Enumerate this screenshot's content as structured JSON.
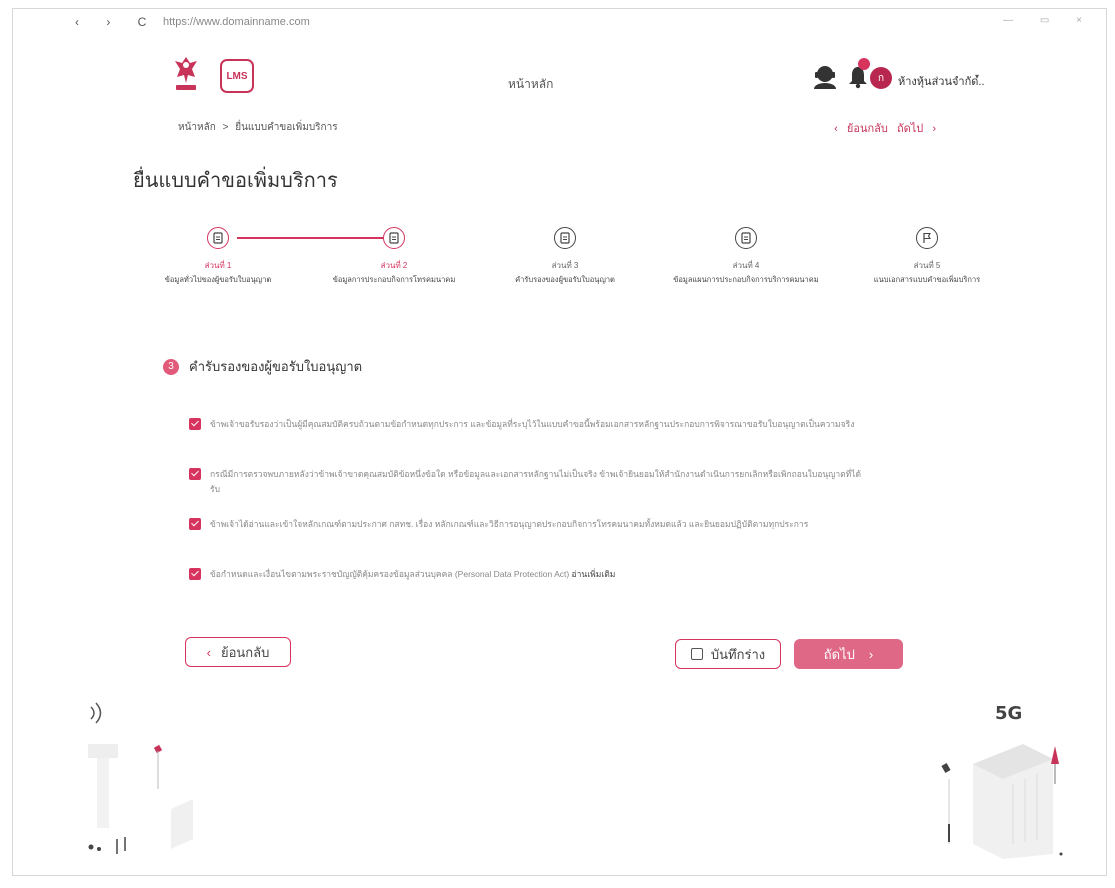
{
  "browser": {
    "url": "https://www.domainname.com",
    "nav_glyphs": "‹ › C",
    "window_glyphs": "— ▭ ×"
  },
  "header": {
    "home_title": "หน้าหลัก",
    "logo2_text": "LMS",
    "user_name": "ห้างหุ้นส่วนจำกัด..",
    "avatar_letter": "ก",
    "chevron": "▾"
  },
  "breadcrumb": {
    "home": "หน้าหลัก",
    "separator": ">",
    "current": "ยื่นแบบคำขอเพิ่มบริการ"
  },
  "top_nav": {
    "back": "ย้อนกลับ",
    "next": "ถัดไป",
    "back_glyph": "‹",
    "next_glyph": "›"
  },
  "page_title": "ยื่นแบบคำขอเพิ่มบริการ",
  "steps": [
    {
      "no": "ส่วนที่ 1",
      "label": "ข้อมูลทั่วไปของผู้ขอรับใบอนุญาต"
    },
    {
      "no": "ส่วนที่ 2",
      "label": "ข้อมูลการประกอบกิจการโทรคมนาคม"
    },
    {
      "no": "ส่วนที่ 3",
      "label": "คำรับรองของผู้ขอรับใบอนุญาต"
    },
    {
      "no": "ส่วนที่ 4",
      "label": "ข้อมูลแผนการประกอบกิจการบริการคมนาคม"
    },
    {
      "no": "ส่วนที่ 5",
      "label": "แนบเอกสารแบบคำขอเพิ่มบริการ"
    }
  ],
  "section": {
    "number": "3",
    "title": "คำรับรองของผู้ขอรับใบอนุญาต"
  },
  "checks": [
    {
      "text": "ข้าพเจ้าขอรับรองว่าเป็นผู้มีคุณสมบัติครบถ้วนตามข้อกำหนดทุกประการ และข้อมูลที่ระบุไว้ในแบบคำขอนี้พร้อมเอกสารหลักฐานประกอบการพิจารณาขอรับใบอนุญาตเป็นความจริง",
      "link": ""
    },
    {
      "text": "กรณีมีการตรวจพบภายหลังว่าข้าพเจ้าขาดคุณสมบัติข้อหนึ่งข้อใด หรือข้อมูลและเอกสารหลักฐานไม่เป็นจริง ข้าพเจ้ายินยอมให้สำนักงานดำเนินการยกเลิกหรือเพิกถอนใบอนุญาตที่ได้รับ",
      "link": ""
    },
    {
      "text": "ข้าพเจ้าได้อ่านและเข้าใจหลักเกณฑ์ตามประกาศ กสทช. เรื่อง หลักเกณฑ์และวิธีการอนุญาตประกอบกิจการโทรคมนาคมทั้งหมดแล้ว และยินยอมปฏิบัติตามทุกประการ",
      "link": ""
    },
    {
      "text": "ข้อกำหนดและเงื่อนไขตามพระราชบัญญัติคุ้มครองข้อมูลส่วนบุคคล (Personal Data Protection Act) ",
      "link": "อ่านเพิ่มเติม"
    }
  ],
  "buttons": {
    "back": "ย้อนกลับ",
    "draft": "บันทึกร่าง",
    "next": "ถัดไป",
    "back_glyph": "‹",
    "next_glyph": "›"
  },
  "decor": {
    "tower_5g_label": "5G"
  },
  "colors": {
    "accent": "#d6335e",
    "next_button": "#de6886"
  }
}
